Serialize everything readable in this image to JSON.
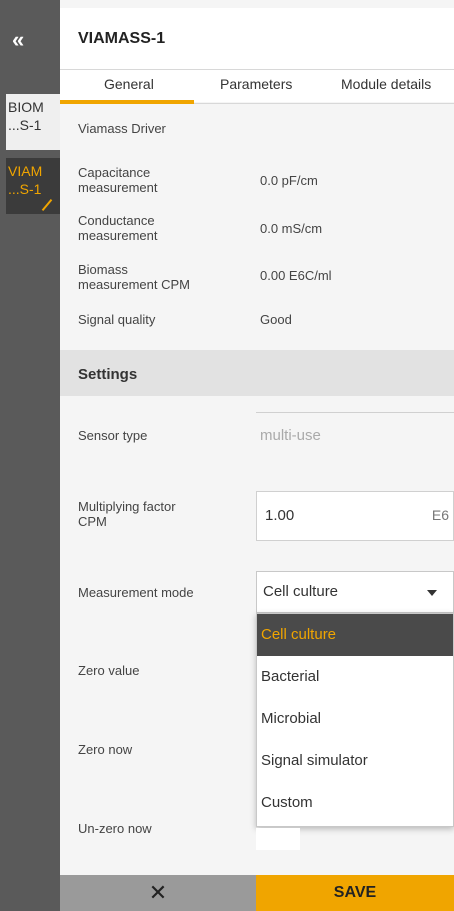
{
  "sidebar": {
    "collapse_icon": "«",
    "items": [
      {
        "label_top": "BIOM",
        "label_bottom": "...S-1"
      },
      {
        "label_top": "VIAM",
        "label_bottom": "...S-1"
      }
    ]
  },
  "header": {
    "title": "VIAMASS-1"
  },
  "tabs": [
    "General",
    "Parameters",
    "Module details"
  ],
  "general": {
    "driver": "Viamass Driver",
    "rows": [
      {
        "label_1": "Capacitance",
        "label_2": "measurement",
        "value": "0.0 pF/cm"
      },
      {
        "label_1": "Conductance",
        "label_2": "measurement",
        "value": "0.0 mS/cm"
      },
      {
        "label_1": "Biomass",
        "label_2": "measurement CPM",
        "value": "0.00 E6C/ml"
      },
      {
        "label_1": "Signal quality",
        "label_2": "",
        "value": "Good"
      }
    ]
  },
  "settings": {
    "title": "Settings",
    "sensor_type_label": "Sensor type",
    "sensor_type_value": "multi-use",
    "factor_label_1": "Multiplying factor",
    "factor_label_2": "CPM",
    "factor_value": "1.00",
    "factor_unit": "E6",
    "mode_label": "Measurement mode",
    "mode_value": "Cell culture",
    "mode_options": [
      "Cell culture",
      "Bacterial",
      "Microbial",
      "Signal simulator",
      "Custom"
    ],
    "zero_value_label": "Zero value",
    "zero_now_label": "Zero now",
    "unzero_label": "Un-zero now"
  },
  "footer": {
    "cancel_icon": "✕",
    "save_label": "SAVE"
  },
  "colors": {
    "accent": "#f0a500",
    "sidebar": "#5a5a5a",
    "selected": "#4a4a4a"
  }
}
